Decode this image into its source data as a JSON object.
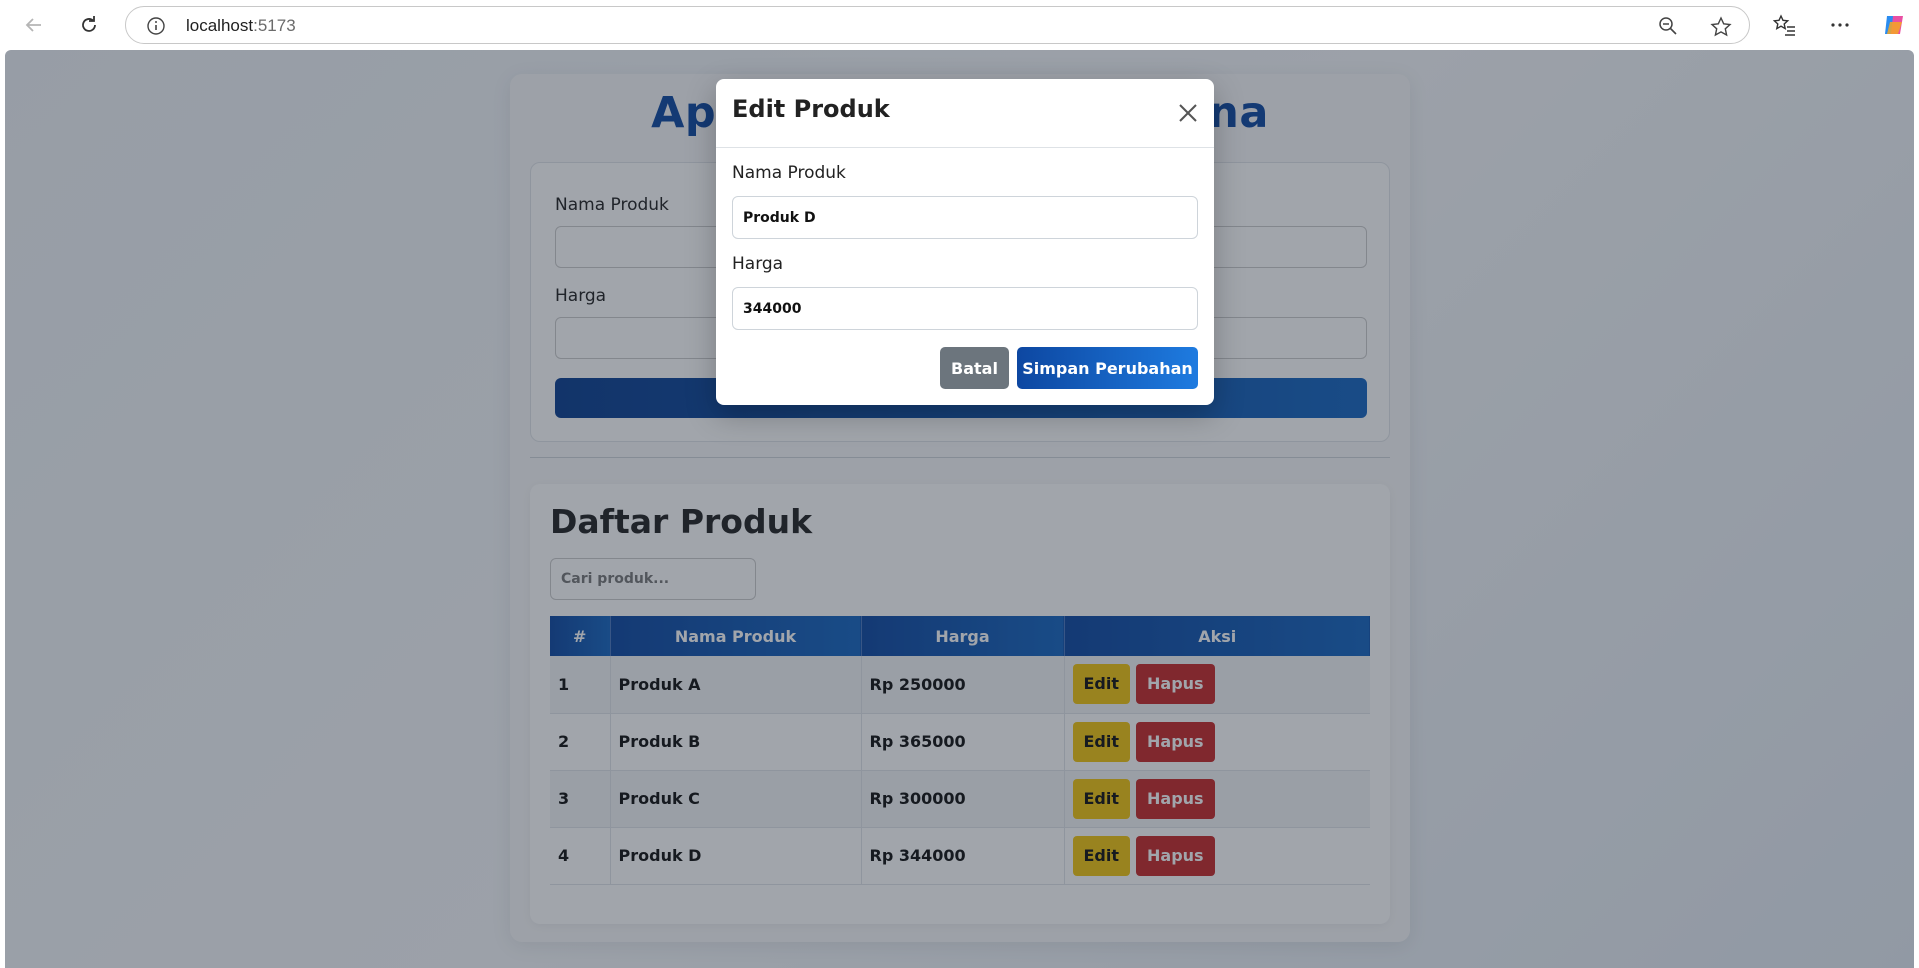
{
  "browser": {
    "url_host": "localhost",
    "url_port": ":5173"
  },
  "app": {
    "title": "Aplikasi Kasir Sederhana",
    "form": {
      "name_label": "Nama Produk",
      "price_label": "Harga"
    },
    "list": {
      "title": "Daftar Produk",
      "search_placeholder": "Cari produk...",
      "headers": [
        "#",
        "Nama Produk",
        "Harga",
        "Aksi"
      ],
      "rows": [
        {
          "no": "1",
          "name": "Produk A",
          "price": "Rp 250000"
        },
        {
          "no": "2",
          "name": "Produk B",
          "price": "Rp 365000"
        },
        {
          "no": "3",
          "name": "Produk C",
          "price": "Rp 300000"
        },
        {
          "no": "4",
          "name": "Produk D",
          "price": "Rp 344000"
        }
      ],
      "edit_label": "Edit",
      "delete_label": "Hapus"
    }
  },
  "modal": {
    "title": "Edit Produk",
    "name_label": "Nama Produk",
    "name_value": "Produk D",
    "price_label": "Harga",
    "price_value": "344000",
    "cancel_label": "Batal",
    "save_label": "Simpan Perubahan"
  },
  "colors": {
    "primary": "#0d47a1",
    "edit": "#f1c40f",
    "delete": "#c62828",
    "cancel": "#6c757d"
  }
}
